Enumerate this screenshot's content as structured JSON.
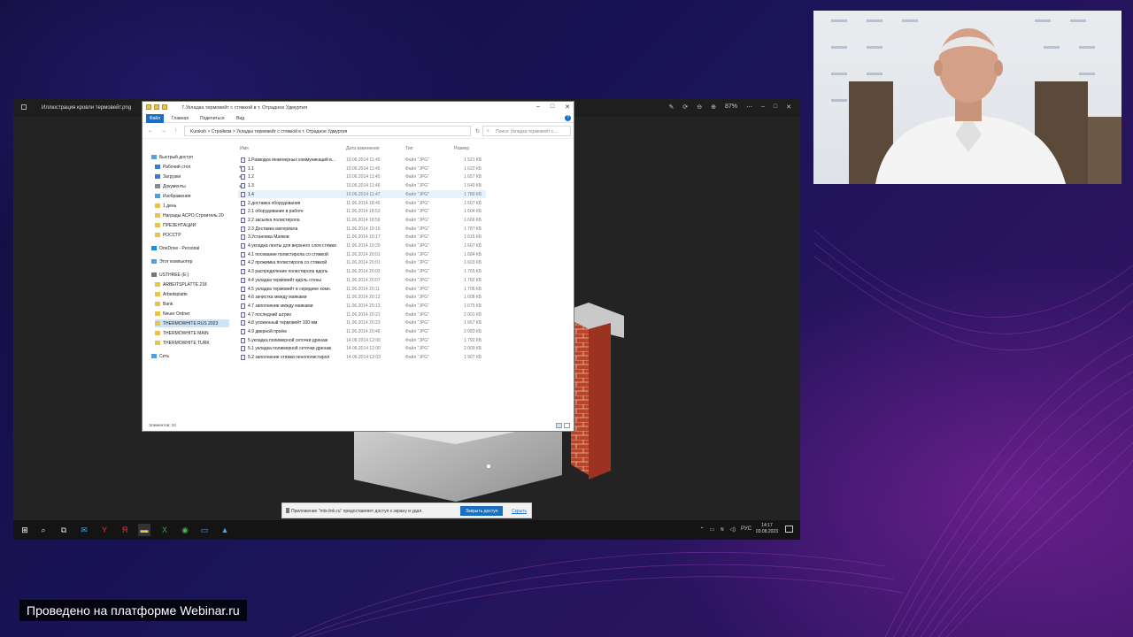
{
  "viewer": {
    "title": "Иллюстрация кровли термовейт.png",
    "zoom": "87%"
  },
  "explorer": {
    "title": "7.Укладка термовейт с стяжкой в т. Отрадное Удмуртия",
    "ribbon_tabs": [
      "Файл",
      "Главная",
      "Поделиться",
      "Вид"
    ],
    "path": "Kursksh  >  Стройком  >  Укладка термовейт с стяжкой в т. Отрадное Удмуртия",
    "search_placeholder": "Поиск: Укладка термовейт с...",
    "columns": {
      "name": "Имя",
      "date": "Дата изменения",
      "type": "Тип",
      "size": "Размер"
    },
    "nav_items": [
      {
        "label": "Быстрый доступ"
      },
      {
        "label": "Рабочий стол"
      },
      {
        "label": "Загрузки"
      },
      {
        "label": "Документы"
      },
      {
        "label": "Изображения"
      },
      {
        "label": "1 день"
      },
      {
        "label": "Награды АСРО Строитель 20"
      },
      {
        "label": "ПРЕЗЕНТАЦИИ"
      },
      {
        "label": "РОССТР"
      },
      {
        "label": "OneDrive - Personal"
      },
      {
        "label": "Этот компьютер"
      },
      {
        "label": "USTHREE (E:)"
      },
      {
        "label": "ARBEITSPLATTE 218"
      },
      {
        "label": "Arbeitsplatte"
      },
      {
        "label": "Bank"
      },
      {
        "label": "Neuer Ordner"
      },
      {
        "label": "THERMOWHITE RUS 2023"
      },
      {
        "label": "THERMOWHITE MAIN"
      },
      {
        "label": "THERMOWHITE TURK"
      },
      {
        "label": "Сеть"
      }
    ],
    "files": [
      {
        "name": "1.Разводка инженерных коммуникаций в...",
        "date": "10.06.2014 11:45",
        "type": "Файл \"JPG\"",
        "size": "1 521 КБ"
      },
      {
        "name": "1.1",
        "date": "10.06.2014 11:45",
        "type": "Файл \"JPG\"",
        "size": "1 622 КБ"
      },
      {
        "name": "1.2",
        "date": "10.06.2014 11:45",
        "type": "Файл \"JPG\"",
        "size": "1 657 КБ"
      },
      {
        "name": "1.3",
        "date": "10.06.2014 11:46",
        "type": "Файл \"JPG\"",
        "size": "1 640 КБ"
      },
      {
        "name": "1.4",
        "date": "10.06.2014 11:47",
        "type": "Файл \"JPG\"",
        "size": "1 789 КБ"
      },
      {
        "name": "2.доставка оборудования",
        "date": "11.06.2014 18:45",
        "type": "Файл \"JPG\"",
        "size": "1 607 КБ"
      },
      {
        "name": "2.1 оборудование в работе",
        "date": "11.06.2014 18:53",
        "type": "Файл \"JPG\"",
        "size": "1 604 КБ"
      },
      {
        "name": "2.2 засыпка полистирола",
        "date": "11.06.2014 18:56",
        "type": "Файл \"JPG\"",
        "size": "1 666 КБ"
      },
      {
        "name": "2.3 Доставка материала",
        "date": "11.06.2014 19:15",
        "type": "Файл \"JPG\"",
        "size": "1 787 КБ"
      },
      {
        "name": "3.Установка Маяков",
        "date": "11.06.2014 19:17",
        "type": "Файл \"JPG\"",
        "size": "1 615 КБ"
      },
      {
        "name": "4.укладка ленты для верхнего слоя стяжки",
        "date": "11.06.2014 19:20",
        "type": "Файл \"JPG\"",
        "size": "1 607 КБ"
      },
      {
        "name": "4.1 посевание полистирола со стяжкой",
        "date": "11.06.2014 20:01",
        "type": "Файл \"JPG\"",
        "size": "1 684 КБ"
      },
      {
        "name": "4.2 прожимка полистирола со стяжкой",
        "date": "11.06.2014 20:01",
        "type": "Файл \"JPG\"",
        "size": "1 603 КБ"
      },
      {
        "name": "4.3 распределение полистирола вдоль",
        "date": "11.06.2014 20:03",
        "type": "Файл \"JPG\"",
        "size": "1 765 КБ"
      },
      {
        "name": "4.4 укладка термовейт вдоль стены",
        "date": "11.06.2014 20:07",
        "type": "Файл \"JPG\"",
        "size": "1 782 КБ"
      },
      {
        "name": "4.5 укладка термовейт в середине комн.",
        "date": "11.06.2014 20:11",
        "type": "Файл \"JPG\"",
        "size": "1 706 КБ"
      },
      {
        "name": "4.6 зачистка между маяками",
        "date": "11.06.2014 20:12",
        "type": "Файл \"JPG\"",
        "size": "1 608 КБ"
      },
      {
        "name": "4.7 заполнение между маяками",
        "date": "11.06.2014 20:13",
        "type": "Файл \"JPG\"",
        "size": "1 675 КБ"
      },
      {
        "name": "4.7 последний штрих",
        "date": "11.06.2014 20:21",
        "type": "Файл \"JPG\"",
        "size": "2 001 КБ"
      },
      {
        "name": "4.8 уложенный термовейт 100 мм",
        "date": "11.06.2014 20:23",
        "type": "Файл \"JPG\"",
        "size": "1 667 КБ"
      },
      {
        "name": "4.9 дверной проём",
        "date": "11.06.2014 20:46",
        "type": "Файл \"JPG\"",
        "size": "2 083 КБ"
      },
      {
        "name": "5.укладка полимерной сеточки дренаж",
        "date": "14.06.2014 12:00",
        "type": "Файл \"JPG\"",
        "size": "1 792 КБ"
      },
      {
        "name": "5.1 укладка полимерной сеточки дренаж",
        "date": "14.06.2014 12:00",
        "type": "Файл \"JPG\"",
        "size": "2 009 КБ"
      },
      {
        "name": "5.2 заполнение стяжки пенополистирол",
        "date": "14.06.2014 12:03",
        "type": "Файл \"JPG\"",
        "size": "1 907 КБ"
      }
    ],
    "status": "Элементов: 24"
  },
  "notification": {
    "message": "Приложение \"mts-link.ru\" предоставляет доступ к экрану и удал.",
    "stop_label": "Закрыть доступ",
    "hide_label": "Скрыть"
  },
  "taskbar": {
    "tray_lang": "РУС",
    "time": "14:17",
    "date": "03.08.2023"
  },
  "branding": {
    "label": "Проведено на платформе Webinar.ru"
  },
  "colors": {
    "accent": "#1a6fc4",
    "background": "#15114a"
  }
}
